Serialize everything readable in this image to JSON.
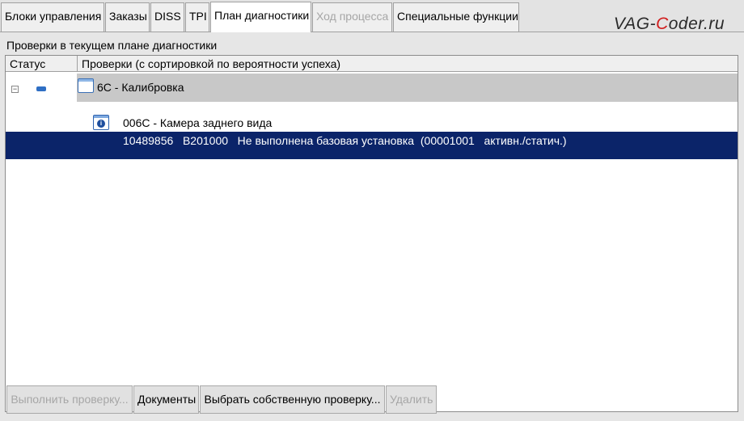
{
  "tabs": [
    {
      "label": "Блоки управления",
      "state": "normal"
    },
    {
      "label": "Заказы",
      "state": "normal"
    },
    {
      "label": "DISS",
      "state": "normal"
    },
    {
      "label": "TPI",
      "state": "normal"
    },
    {
      "label": "План диагностики",
      "state": "active"
    },
    {
      "label": "Ход процесса",
      "state": "disabled"
    },
    {
      "label": "Специальные функции",
      "state": "normal"
    }
  ],
  "logo": {
    "part1": "VAG-",
    "part2": "C",
    "part3": "oder.ru"
  },
  "panel": {
    "section_title": "Проверки в текущем плане диагностики",
    "columns": {
      "status": "Статус",
      "checks": "Проверки (с сортировкой по вероятности успеха)"
    },
    "group": {
      "label": "6C - Калибровка",
      "expanded_symbol": "−"
    },
    "sub_item": {
      "label": "006C - Камера заднего вида",
      "icon": "info-icon"
    },
    "selected_row": {
      "text": "10489856   B201000   Не выполнена базовая установка  (00001001   активн./статич.)"
    }
  },
  "buttons": {
    "run_check": "Выполнить проверку...",
    "documents": "Документы",
    "choose_own_check": "Выбрать собственную проверку...",
    "delete": "Удалить"
  },
  "colors": {
    "selection": "#0b2469",
    "group_bg": "#c8c8c8",
    "logo_accent": "#d11c1c"
  }
}
